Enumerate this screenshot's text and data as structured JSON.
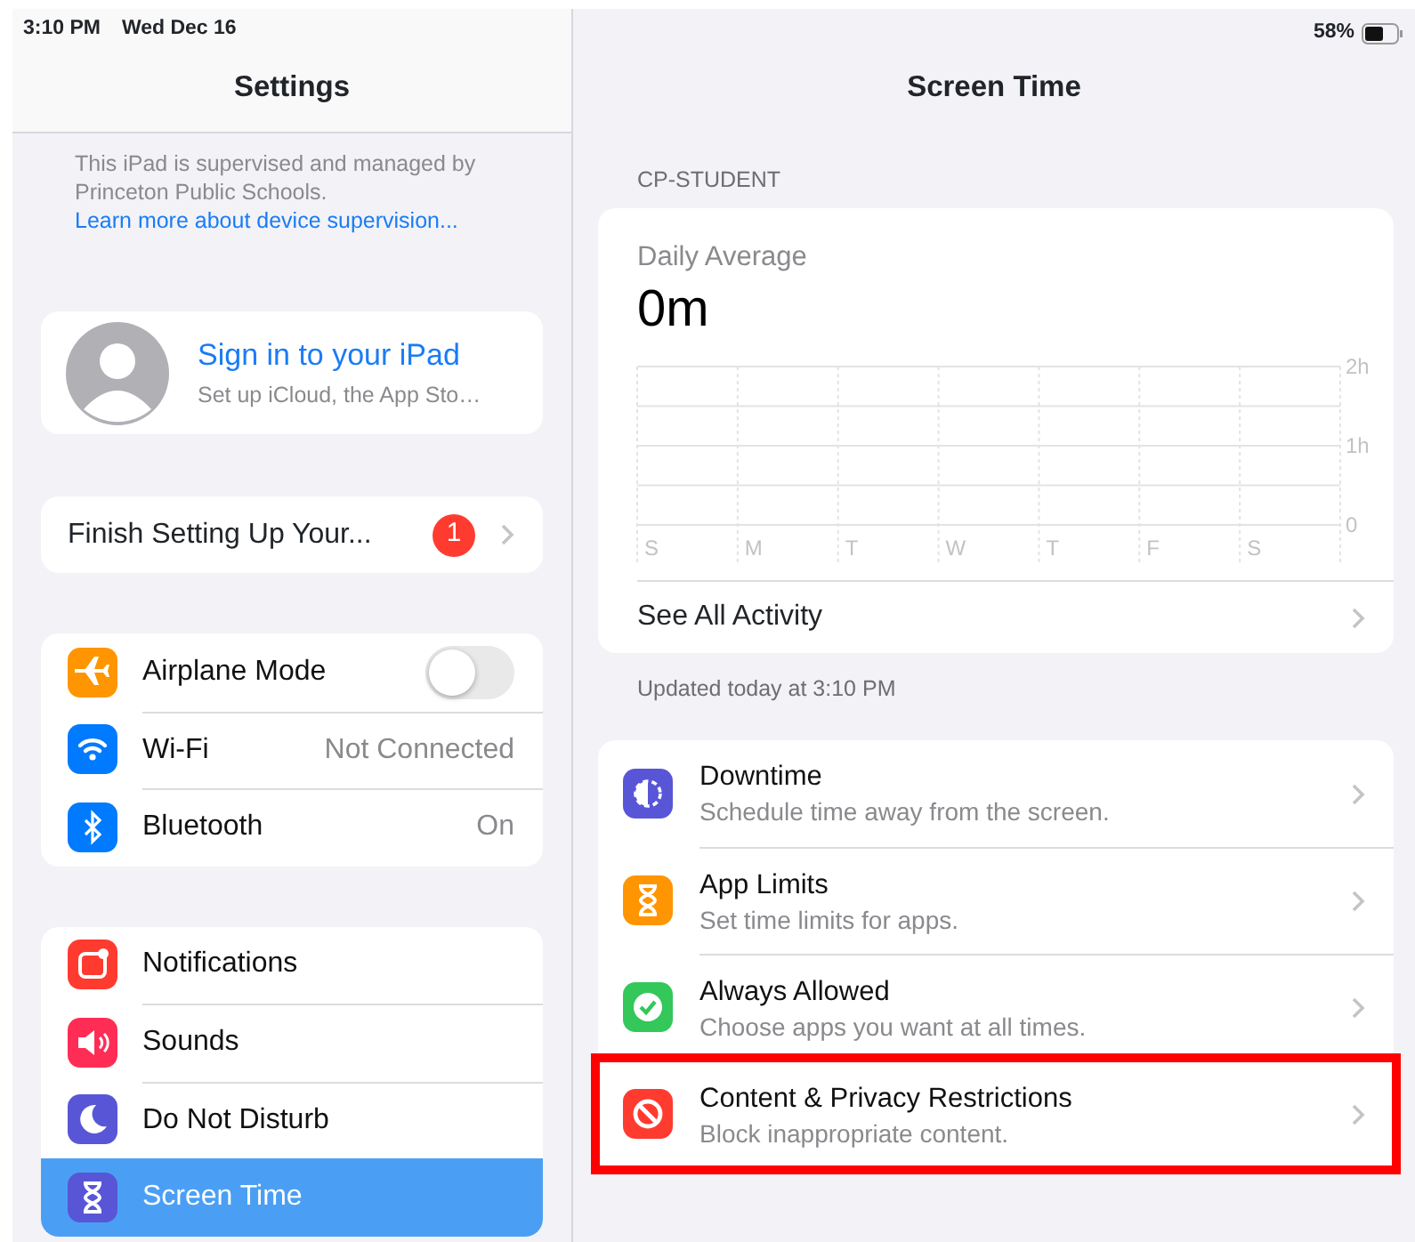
{
  "status_bar": {
    "time": "3:10 PM",
    "date": "Wed Dec 16",
    "battery": "58%"
  },
  "sidebar": {
    "title": "Settings",
    "supervision_note": {
      "text": "This iPad is supervised and managed by Princeton Public Schools.",
      "link": "Learn more about device supervision..."
    },
    "account": {
      "name": "Sign in to your iPad",
      "subtitle": "Set up iCloud, the App Sto…"
    },
    "setup": {
      "label": "Finish Setting Up Your...",
      "badge": "1"
    },
    "groups": [
      [
        {
          "kind": "toggle",
          "label": "Airplane Mode",
          "on": false,
          "color": "#ff9500",
          "selected": false
        },
        {
          "kind": "value",
          "label": "Wi-Fi",
          "value": "Not Connected",
          "color": "#007aff",
          "selected": false
        },
        {
          "kind": "value",
          "label": "Bluetooth",
          "value": "On",
          "color": "#007aff",
          "selected": false
        }
      ],
      [
        {
          "kind": "plain",
          "label": "Notifications",
          "color": "#ff3b30",
          "selected": false
        },
        {
          "kind": "plain",
          "label": "Sounds",
          "color": "#ff2d55",
          "selected": false
        },
        {
          "kind": "plain",
          "label": "Do Not Disturb",
          "color": "#5856d6",
          "selected": false
        },
        {
          "kind": "plain",
          "label": "Screen Time",
          "color": "#5856d6",
          "selected": true
        }
      ]
    ]
  },
  "detail": {
    "title": "Screen Time",
    "section": "CP-STUDENT",
    "daily_average": {
      "label": "Daily Average",
      "value": "0m",
      "chart_data": {
        "type": "bar",
        "categories": [
          "S",
          "M",
          "T",
          "W",
          "T",
          "F",
          "S"
        ],
        "values": [
          0,
          0,
          0,
          0,
          0,
          0,
          0
        ],
        "ylim": [
          0,
          2
        ],
        "yticks": [
          {
            "value": 0,
            "label": "0"
          },
          {
            "value": 1,
            "label": "1h"
          },
          {
            "value": 2,
            "label": "2h"
          }
        ]
      }
    },
    "see_all": "See All Activity",
    "updated": "Updated today at 3:10 PM",
    "options": [
      {
        "title": "Downtime",
        "subtitle": "Schedule time away from the screen.",
        "color": "#5856d6",
        "highlighted": false
      },
      {
        "title": "App Limits",
        "subtitle": "Set time limits for apps.",
        "color": "#ff9500",
        "highlighted": false
      },
      {
        "title": "Always Allowed",
        "subtitle": "Choose apps you want at all times.",
        "color": "#34c759",
        "highlighted": false
      },
      {
        "title": "Content & Privacy Restrictions",
        "subtitle": "Block inappropriate content.",
        "color": "#ff3b30",
        "highlighted": true
      }
    ]
  }
}
